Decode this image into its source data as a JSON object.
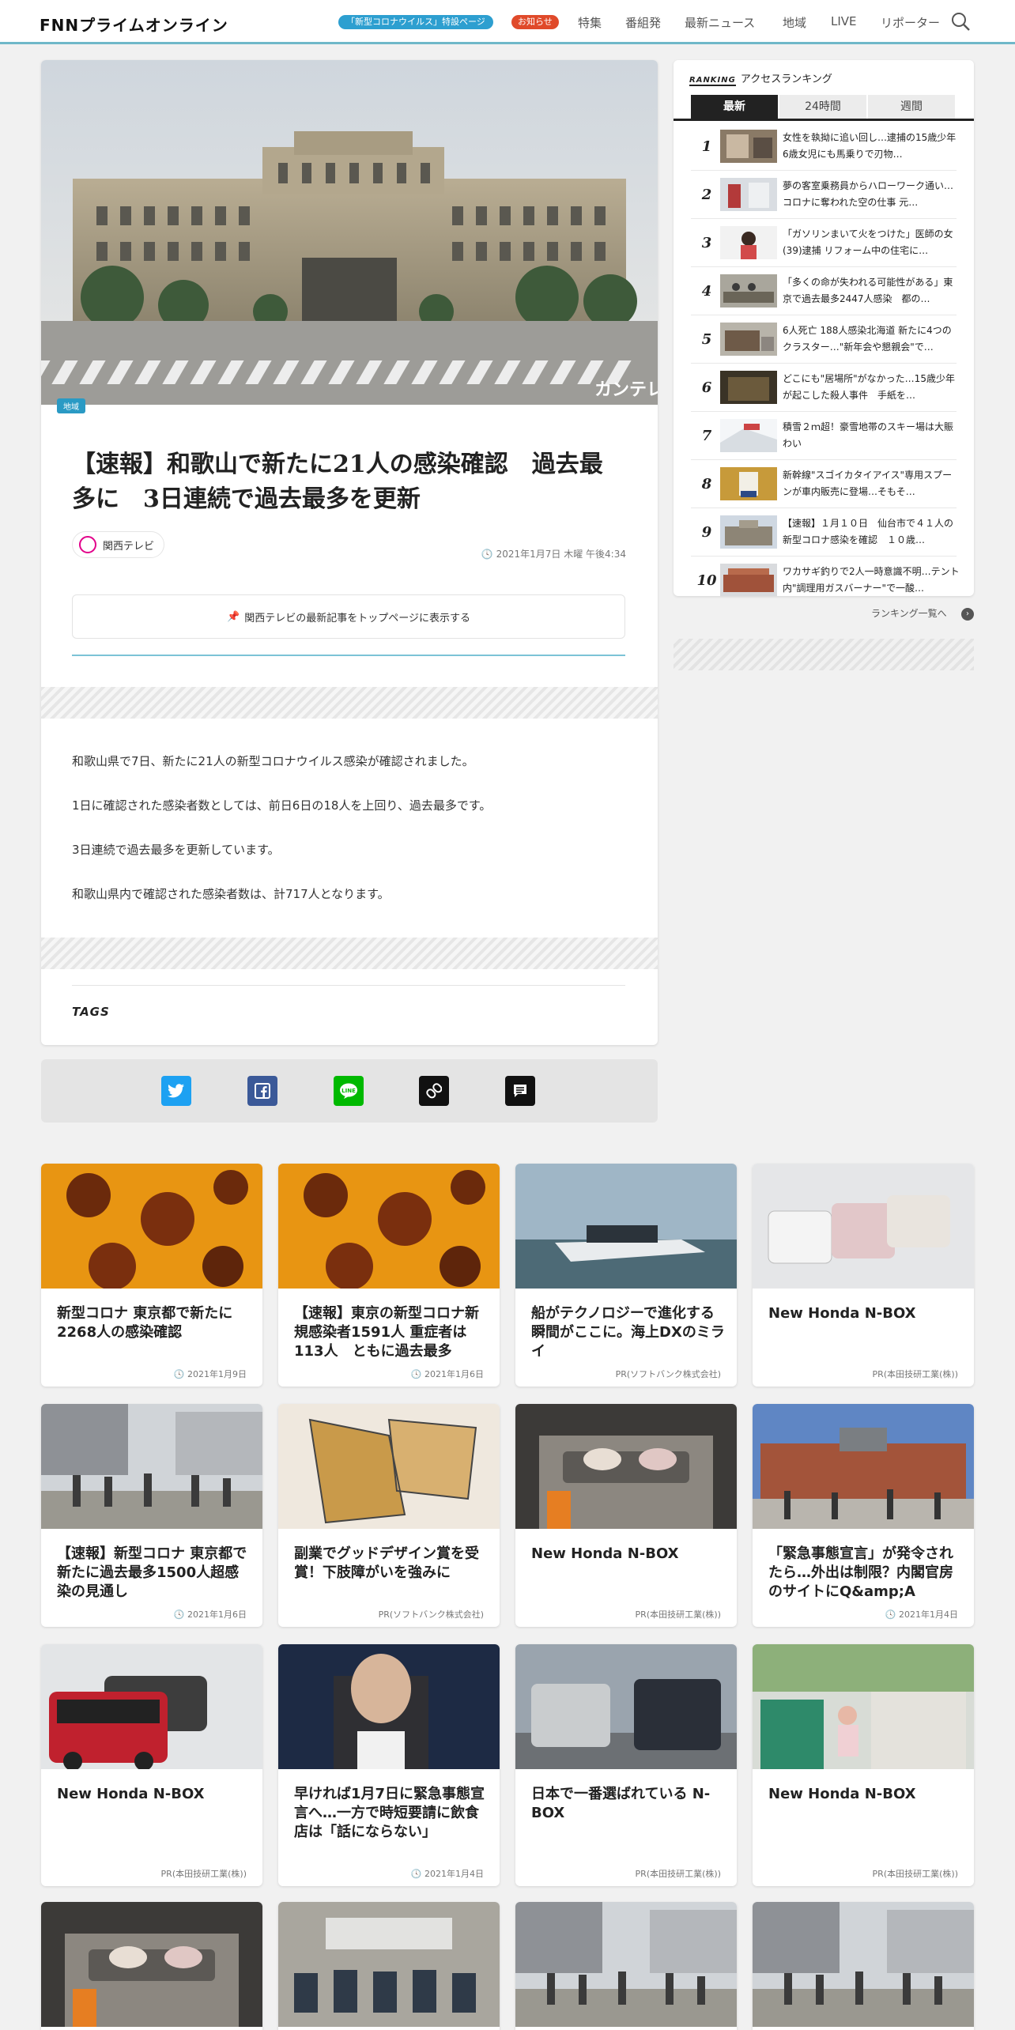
{
  "header": {
    "logo": "FNNプライムオンライン",
    "corona_pill": "「新型コロナウイルス」特設ページ",
    "notice_pill": "お知らせ",
    "nav": [
      "特集",
      "番組発",
      "最新ニュース",
      "地域",
      "LIVE",
      "リポーター"
    ],
    "search_icon": "search-icon"
  },
  "article": {
    "region_badge": "地域",
    "image_watermark": "カンテレ",
    "title": "【速報】和歌山で新たに21人の感染確認　過去最多に　3日連続で過去最多を更新",
    "source": "関西テレビ",
    "date": "2021年1月7日 木曜 午後4:34",
    "pin_button": "関西テレビの最新記事をトップページに表示する",
    "paragraphs": [
      "和歌山県で7日、新たに21人の新型コロナウイルス感染が確認されました。",
      "1日に確認された感染者数としては、前日6日の18人を上回り、過去最多です。",
      "3日連続で過去最多を更新しています。",
      "和歌山県内で確認された感染者数は、計717人となります。"
    ],
    "tags_label": "TAGS"
  },
  "share": {
    "icons": [
      "twitter-icon",
      "facebook-icon",
      "line-icon",
      "copy-link-icon",
      "comment-icon"
    ],
    "colors": {
      "twitter": "#1da1f2",
      "facebook": "#3b5998",
      "line": "#00b900",
      "link": "#111111",
      "comment": "#111111"
    }
  },
  "ranking": {
    "badge": "RANKING",
    "title": "アクセスランキング",
    "tabs": [
      "最新",
      "24時間",
      "週間"
    ],
    "active_tab": "最新",
    "items": [
      {
        "rank": "1",
        "text": "女性を執拗に追い回し…逮捕の15歳少年　6歳女児にも馬乗りで刃物…"
      },
      {
        "rank": "2",
        "text": "夢の客室乗務員からハローワーク通い…コロナに奪われた空の仕事 元…"
      },
      {
        "rank": "3",
        "text": "「ガソリンまいて火をつけた」医師の女(39)逮捕 リフォーム中の住宅に…"
      },
      {
        "rank": "4",
        "text": "「多くの命が失われる可能性がある」東京で過去最多2447人感染　都の…"
      },
      {
        "rank": "5",
        "text": "6人死亡 188人感染北海道 新たに4つのクラスター…\"新年会や懇親会\"で…"
      },
      {
        "rank": "6",
        "text": "どこにも\"居場所\"がなかった…15歳少年が起こした殺人事件　手紙を…"
      },
      {
        "rank": "7",
        "text": "積雪２ｍ超！豪雪地帯のスキー場は大賑わい"
      },
      {
        "rank": "8",
        "text": "新幹線\"スゴイカタイアイス\"専用スプーンが車内販売に登場…そもそ…"
      },
      {
        "rank": "9",
        "text": "【速報】１月１０日　仙台市で４１人の新型コロナ感染を確認　１０歳…"
      },
      {
        "rank": "10",
        "text": "ワカサギ釣りで2人一時意識不明…テント内\"調理用ガスバーナー\"で一酸…"
      }
    ],
    "more": "ランキング一覧へ"
  },
  "cards": [
    {
      "title": "新型コロナ 東京都で新たに2268人の感染確認",
      "meta": "2021年1月9日",
      "is_date": true
    },
    {
      "title": "【速報】東京の新型コロナ新規感染者1591人 重症者は113人　ともに過去最多",
      "meta": "2021年1月6日",
      "is_date": true
    },
    {
      "title": "船がテクノロジーで進化する瞬間がここに。海上DXのミライ",
      "meta": "PR(ソフトバンク株式会社)",
      "is_date": false
    },
    {
      "title": "New Honda N-BOX",
      "meta": "PR(本田技研工業(株))",
      "is_date": false
    },
    {
      "title": "【速報】新型コロナ 東京都で新たに過去最多1500人超感染の見通し",
      "meta": "2021年1月6日",
      "is_date": true
    },
    {
      "title": "副業でグッドデザイン賞を受賞！下肢障がいを強みに",
      "meta": "PR(ソフトバンク株式会社)",
      "is_date": false
    },
    {
      "title": "New Honda N-BOX",
      "meta": "PR(本田技研工業(株))",
      "is_date": false
    },
    {
      "title": "「緊急事態宣言」が発令されたら…外出は制限？内閣官房のサイトにQ&amp;A",
      "meta": "2021年1月4日",
      "is_date": true
    },
    {
      "title": "New Honda N-BOX",
      "meta": "PR(本田技研工業(株))",
      "is_date": false
    },
    {
      "title": "早ければ1月7日に緊急事態宣言へ…一方で時短要請に飲食店は「話にならない」",
      "meta": "2021年1月4日",
      "is_date": true
    },
    {
      "title": "日本で一番選ばれている N-BOX",
      "meta": "PR(本田技研工業(株))",
      "is_date": false
    },
    {
      "title": "New Honda N-BOX",
      "meta": "PR(本田技研工業(株))",
      "is_date": false
    }
  ]
}
